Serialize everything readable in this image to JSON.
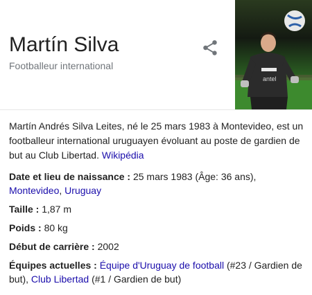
{
  "header": {
    "name": "Martín Silva",
    "subtitle": "Footballeur international",
    "share_icon": "share-icon",
    "photo_icon": "player-photo"
  },
  "description": {
    "text": "Martín Andrés Silva Leites, né le 25 mars 1983 à Montevideo, est un footballeur international uruguayen évoluant au poste de gardien de but au Club Libertad.",
    "source_link": "Wikipédia"
  },
  "facts": {
    "birth": {
      "label": "Date et lieu de naissance :",
      "value": "25 mars 1983 (Âge: 36 ans),",
      "link1": "Montevideo",
      "sep": ",",
      "link2": "Uruguay"
    },
    "height": {
      "label": "Taille :",
      "value": "1,87 m"
    },
    "weight": {
      "label": "Poids :",
      "value": "80 kg"
    },
    "career_start": {
      "label": "Début de carrière :",
      "value": "2002"
    },
    "teams": {
      "label": "Équipes actuelles :",
      "team1": "Équipe d'Uruguay de football",
      "team1_detail": "(#23 / Gardien de but),",
      "team2": "Club Libertad",
      "team2_detail": "(#1 / Gardien de but)"
    }
  },
  "colors": {
    "link": "#1a0dab",
    "muted": "#70757a",
    "text": "#222222"
  }
}
